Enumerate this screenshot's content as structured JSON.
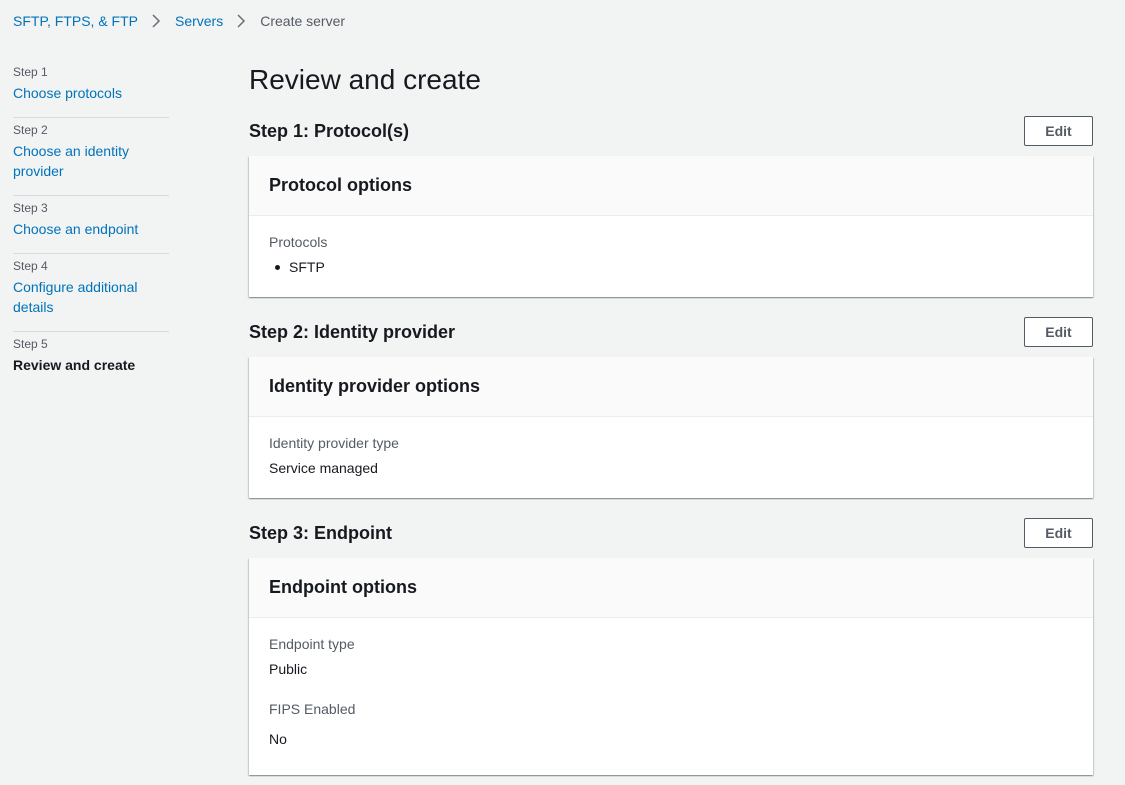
{
  "breadcrumb": {
    "items": [
      "SFTP, FTPS, & FTP",
      "Servers"
    ],
    "current": "Create server"
  },
  "steps": [
    {
      "num": "Step 1",
      "label": "Choose protocols"
    },
    {
      "num": "Step 2",
      "label": "Choose an identity provider"
    },
    {
      "num": "Step 3",
      "label": "Choose an endpoint"
    },
    {
      "num": "Step 4",
      "label": "Configure additional details"
    },
    {
      "num": "Step 5",
      "label": "Review and create"
    }
  ],
  "page": {
    "title": "Review and create"
  },
  "sections": [
    {
      "title": "Step 1: Protocol(s)",
      "edit_label": "Edit",
      "card_title": "Protocol options",
      "field_label": "Protocols",
      "list": [
        "SFTP"
      ]
    },
    {
      "title": "Step 2: Identity provider",
      "edit_label": "Edit",
      "card_title": "Identity provider options",
      "field_label": "Identity provider type",
      "field_value": "Service managed"
    },
    {
      "title": "Step 3: Endpoint",
      "edit_label": "Edit",
      "card_title": "Endpoint options",
      "fields": [
        {
          "label": "Endpoint type",
          "value": "Public"
        },
        {
          "label": "FIPS Enabled",
          "value": "No"
        }
      ]
    }
  ],
  "colors": {
    "link": "#0073bb",
    "background": "#f2f3f3",
    "text": "#16191f",
    "secondary": "#545b64"
  },
  "icons": {
    "breadcrumb_separator": "chevron-right-icon"
  }
}
